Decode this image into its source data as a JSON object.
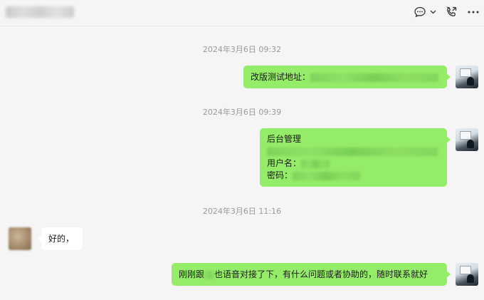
{
  "header": {
    "title": "",
    "icons": [
      "chat-bubble-icon",
      "chevron-down-icon",
      "phone-call-icon",
      "more-icon"
    ]
  },
  "messages": [
    {
      "time": "2024年3月6日 09:32",
      "sender": "me",
      "lines": [
        {
          "label": "改版测试地址："
        }
      ]
    },
    {
      "time": "2024年3月6日 09:39",
      "sender": "me",
      "lines": [
        {
          "label": "后台管理"
        },
        {
          "label": ""
        },
        {
          "label": "用户名："
        },
        {
          "label": "密码："
        }
      ]
    },
    {
      "time": "2024年3月6日 11:16",
      "sender": "them",
      "lines": [
        {
          "label": "好的，"
        }
      ]
    },
    {
      "time": "",
      "sender": "me",
      "lines": [
        {
          "part1": "刚刚跟",
          "part2": "也语音对接了下，有什么问题或者协助的，随时联系就好"
        }
      ]
    }
  ],
  "colors": {
    "my_bubble": "#95ec69",
    "their_bubble": "#ffffff",
    "background": "#f5f5f5"
  }
}
